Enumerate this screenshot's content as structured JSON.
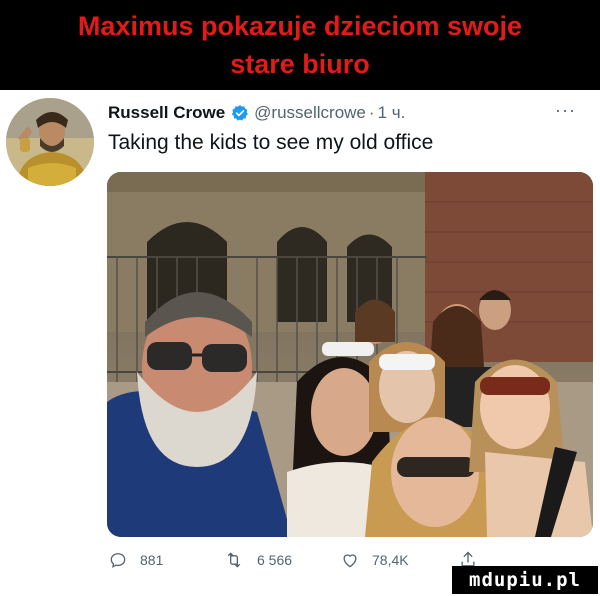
{
  "banner": {
    "line1": "Maximus pokazuje dzieciom swoje",
    "line2": "stare biuro"
  },
  "tweet": {
    "author": "Russell Crowe",
    "handle": "@russellcrowe",
    "separator": "·",
    "time": "1 ч.",
    "more": "···",
    "text": "Taking the kids to see my old office",
    "verified_color": "#1d9bf0"
  },
  "actions": {
    "replies": "881",
    "retweets": "6 566",
    "likes": "78,4K"
  },
  "watermark": "mdupiu.pl",
  "icons": [
    "verified-badge-icon",
    "more-dots-icon",
    "reply-icon",
    "retweet-icon",
    "like-icon",
    "share-icon"
  ]
}
